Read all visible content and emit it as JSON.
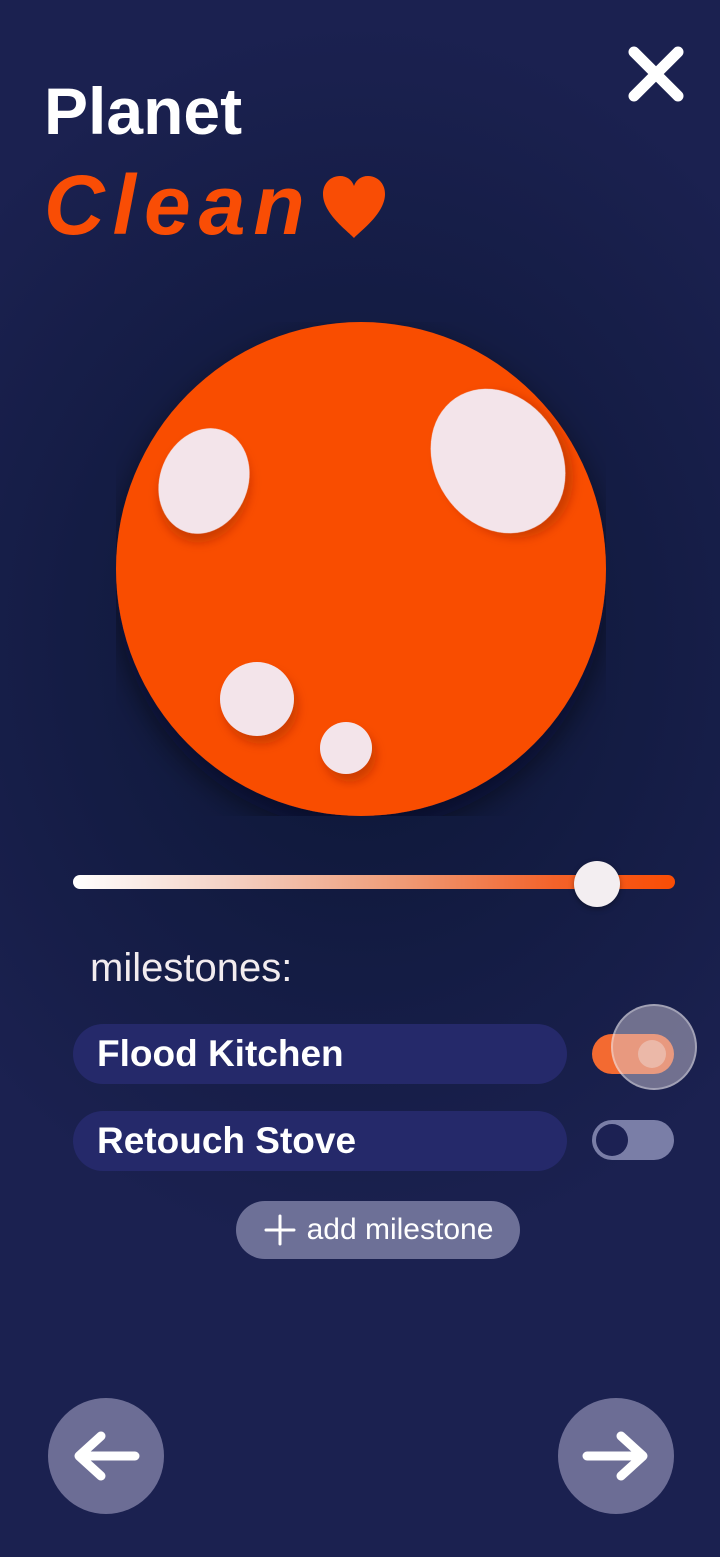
{
  "header": {
    "title_line1": "Planet",
    "title_line2": "Clean",
    "heart_icon": "heart-icon",
    "close_icon": "close-icon"
  },
  "planet": {
    "color": "#f94d05",
    "spot_color": "#f3e4ea"
  },
  "progress": {
    "value": 0.87,
    "track_start_color": "#ffffff",
    "track_end_color": "#f94d05"
  },
  "milestones": {
    "label": "milestones:",
    "items": [
      {
        "label": "Flood Kitchen",
        "enabled": true
      },
      {
        "label": "Retouch Stove",
        "enabled": false
      }
    ],
    "add_label": "add milestone",
    "add_icon": "plus-icon"
  },
  "navigation": {
    "back_icon": "arrow-left-icon",
    "next_icon": "arrow-right-icon"
  },
  "colors": {
    "accent": "#f94d05",
    "background": "#141c44",
    "pill": "#25296a",
    "muted_button": "#6c6d95"
  }
}
